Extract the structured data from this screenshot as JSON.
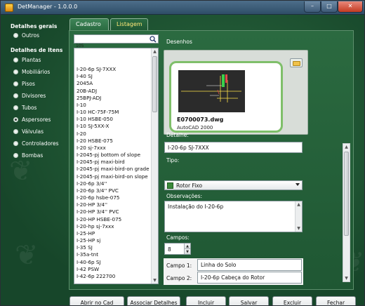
{
  "window": {
    "title": "DetManager - 1.0.0.0",
    "minimize_glyph": "–",
    "maximize_glyph": "□",
    "close_glyph": "✕"
  },
  "sidebar": {
    "general_heading": "Detalhes gerais",
    "general_items": [
      {
        "label": "Outros"
      }
    ],
    "items_heading": "Detalhes de Itens",
    "items": [
      {
        "label": "Plantas"
      },
      {
        "label": "Mobiliários"
      },
      {
        "label": "Pisos"
      },
      {
        "label": "Divisores"
      },
      {
        "label": "Tubos"
      },
      {
        "label": "Aspersores",
        "checked": true
      },
      {
        "label": "Válvulas"
      },
      {
        "label": "Controladores"
      },
      {
        "label": "Bombas"
      }
    ]
  },
  "tabs": [
    {
      "label": "Cadastro",
      "active": true
    },
    {
      "label": "Listagem",
      "active": false
    }
  ],
  "search": {
    "value": "",
    "count_label": "105"
  },
  "list": {
    "items": [
      "I-20-6p SJ-7XXX",
      "I-40 SJ",
      "2045A",
      "20B-ADJ",
      "25BPJ-ADJ",
      "I-10",
      "I-10 HC-75F-75M",
      "I-10 HSBE-050",
      "I-10 SJ-5XX-X",
      "I-20",
      "I-20 HSBE-075",
      "I-20 sj-7xxx",
      "I-2045-pj bottom of slope",
      "I-2045-pj maxi-bird",
      "I-2045-pj maxi-bird-on grade",
      "I-2045-pj maxi-bird-on slope",
      "I-20-6p 3/4''",
      "I-20-6p 3/4'' PVC",
      "I-20-6p hsbe-075",
      "I-20-HP 3/4''",
      "I-20-HP 3/4'' PVC",
      "I-20-HP HSBE-075",
      "I-20-hp sj-7xxx",
      "I-25-HP",
      "I-25-HP sj",
      "I-35 SJ",
      "I-35a-tnt",
      "I-40-6p SJ",
      "I-42 PSW",
      "I-42-6p 222700"
    ]
  },
  "drawings": {
    "label": "Desenhos",
    "file_name": "E0700073.dwg",
    "version": "AutoCAD 2000"
  },
  "form": {
    "detalhe_label": "Detalhe:",
    "detalhe_value": "I-20-6p SJ-7XXX",
    "tipo_label": "Tipo:",
    "tipo_value": "Rotor Fixo",
    "observacoes_label": "Observações:",
    "observacoes_value": "Instalação do I-20-6p",
    "campos_label": "Campos:",
    "campos_value": "8",
    "campos": [
      {
        "label": "Campo 1:",
        "value": "Linha do Solo"
      },
      {
        "label": "Campo 2:",
        "value": "I-20-6p Cabeça do Rotor"
      }
    ]
  },
  "buttons": {
    "abrir": "Abrir no Cad",
    "associar": "Associar Detalhes",
    "incluir": "Incluir",
    "salvar": "Salvar",
    "excluir": "Excluir",
    "fechar": "Fechar"
  },
  "colors": {
    "background": "#1e5532",
    "titlebar": "#3d5a77",
    "tab_active_text": "#ffffff",
    "tab_inactive_text": "#ffe97a",
    "drawing_border": "#7fbf6a"
  }
}
